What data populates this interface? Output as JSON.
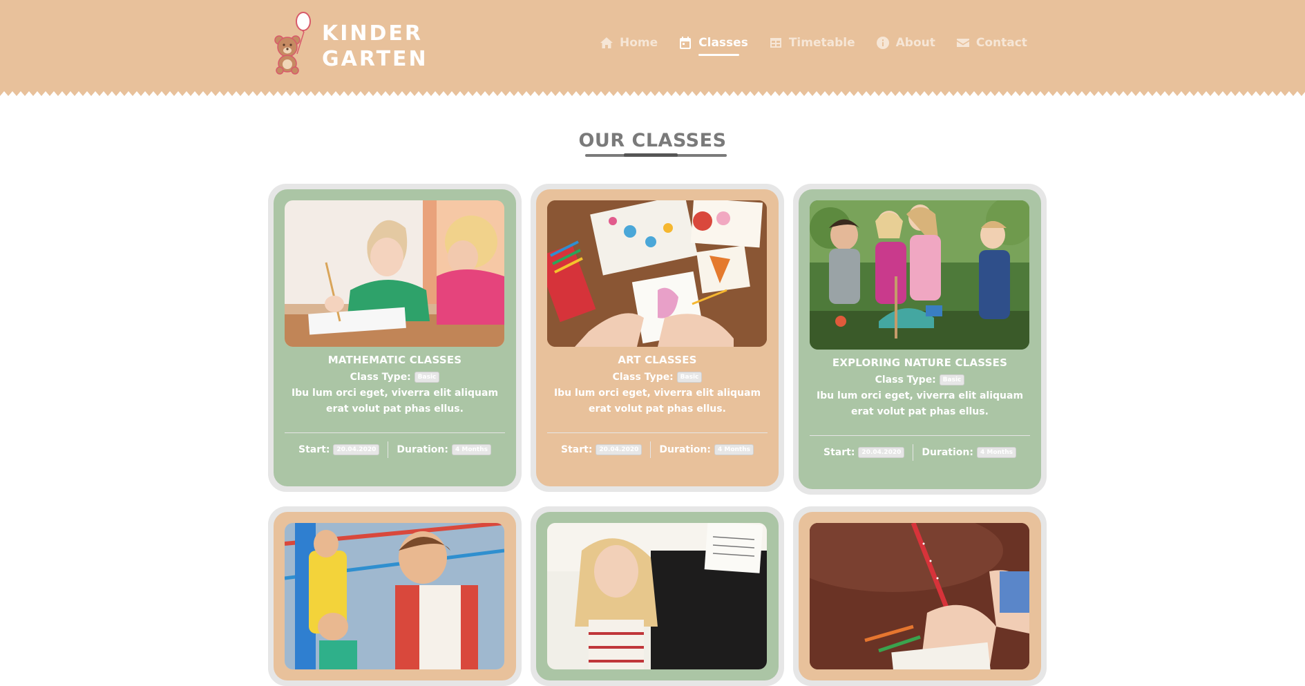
{
  "brand": {
    "line1": "KINDER",
    "line2": "GARTEN",
    "logo_icon": "teddy-bear-balloon-icon"
  },
  "nav": [
    {
      "label": "Home",
      "icon": "home-icon",
      "active": false
    },
    {
      "label": "Classes",
      "icon": "calendar-icon",
      "active": true
    },
    {
      "label": "Timetable",
      "icon": "table-icon",
      "active": false
    },
    {
      "label": "About",
      "icon": "info-icon",
      "active": false
    },
    {
      "label": "Contact",
      "icon": "envelope-icon",
      "active": false
    }
  ],
  "section": {
    "title": "OUR CLASSES"
  },
  "labels": {
    "class_type": "Class Type:",
    "start": "Start:",
    "duration": "Duration:"
  },
  "cards": [
    {
      "title": "MATHEMATIC CLASSES",
      "type": "Basic",
      "description": "Ibu lum orci eget, viverra elit aliquam erat volut pat phas ellus.",
      "start": "20.04.2020",
      "duration": "4 Months",
      "color": "#abc5a5"
    },
    {
      "title": "ART CLASSES",
      "type": "Basic",
      "description": "Ibu lum orci eget, viverra elit aliquam erat volut pat phas ellus.",
      "start": "20.04.2020",
      "duration": "4 Months",
      "color": "#e8c19b"
    },
    {
      "title": "EXPLORING NATURE CLASSES",
      "type": "Basic",
      "description": "Ibu lum orci eget, viverra elit aliquam erat volut pat phas ellus.",
      "start": "20.04.2020",
      "duration": "4 Months",
      "color": "#abc5a5"
    },
    {
      "color": "#e8c19b"
    },
    {
      "color": "#abc5a5"
    },
    {
      "color": "#e8c19b"
    }
  ],
  "colors": {
    "header": "#e8c19b",
    "green": "#abc5a5",
    "tan": "#e8c19b",
    "card_border": "#e6e6e6",
    "title": "#7a7a7a"
  }
}
